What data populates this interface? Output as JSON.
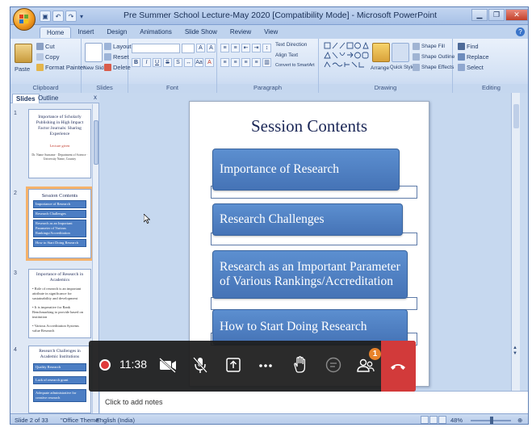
{
  "window": {
    "title": "Pre Summer School Lecture-May 2020 [Compatibility Mode] - Microsoft PowerPoint"
  },
  "tabs": [
    "Home",
    "Insert",
    "Design",
    "Animations",
    "Slide Show",
    "Review",
    "View"
  ],
  "ribbon": {
    "clipboard": {
      "label": "Clipboard",
      "paste": "Paste",
      "cut": "Cut",
      "copy": "Copy",
      "format_painter": "Format Painter"
    },
    "slides": {
      "label": "Slides",
      "new_slide": "New Slide",
      "layout": "Layout",
      "reset": "Reset",
      "delete": "Delete"
    },
    "font": {
      "label": "Font"
    },
    "paragraph": {
      "label": "Paragraph",
      "text_direction": "Text Direction",
      "align_text": "Align Text",
      "convert_smartart": "Convert to SmartArt"
    },
    "drawing": {
      "label": "Drawing",
      "arrange": "Arrange",
      "quick_styles": "Quick Styles",
      "shape_fill": "Shape Fill",
      "shape_outline": "Shape Outline",
      "shape_effects": "Shape Effects"
    },
    "editing": {
      "label": "Editing",
      "find": "Find",
      "replace": "Replace",
      "select": "Select"
    }
  },
  "panel": {
    "tab_slides": "Slides",
    "tab_outline": "Outline",
    "close": "x",
    "thumbs": [
      {
        "num": "1",
        "title": "Importance of Scholarly Publishing in High Impact Factor Journals: Sharing Experience",
        "red": "Lecture given",
        "small": "Dr. Name Surname · Department of Science · University Name, Country"
      },
      {
        "num": "2",
        "title": "Session Contents",
        "boxes": [
          "Importance of Research",
          "Research Challenges",
          "Research as an Important Parameter of Various Rankings/Accreditation",
          "How to Start Doing Research"
        ]
      },
      {
        "num": "3",
        "title": "Importance of Research in Academics",
        "lines": [
          "• Role of research is an important attribute in significance for sustainability and development",
          "• It is imperative for Rank Benchmarking to provide based on institution",
          "• Various Accreditation Systems value Research"
        ]
      },
      {
        "num": "4",
        "title": "Research Challenges in Academic Institutions",
        "boxes": [
          "Quality Research",
          "Lack of research grant",
          "Adequate administrative for creative research"
        ]
      }
    ]
  },
  "slide": {
    "title": "Session Contents",
    "items": [
      "Importance of Research",
      "Research Challenges",
      "Research as an Important Parameter of Various Rankings/Accreditation",
      "How to Start Doing Research"
    ]
  },
  "notes": {
    "placeholder": "Click to add notes"
  },
  "status": {
    "slide_count": "Slide 2 of 33",
    "theme": "\"Office Theme\"",
    "language": "English (India)",
    "zoom": "48%"
  },
  "meeting": {
    "time": "11:38",
    "participants_badge": "1"
  },
  "colors": {
    "ribbon_bg": "#d3e1f4",
    "slide_box": "#4c7ec4",
    "leave": "#d23a3a",
    "badge": "#e8832b"
  }
}
